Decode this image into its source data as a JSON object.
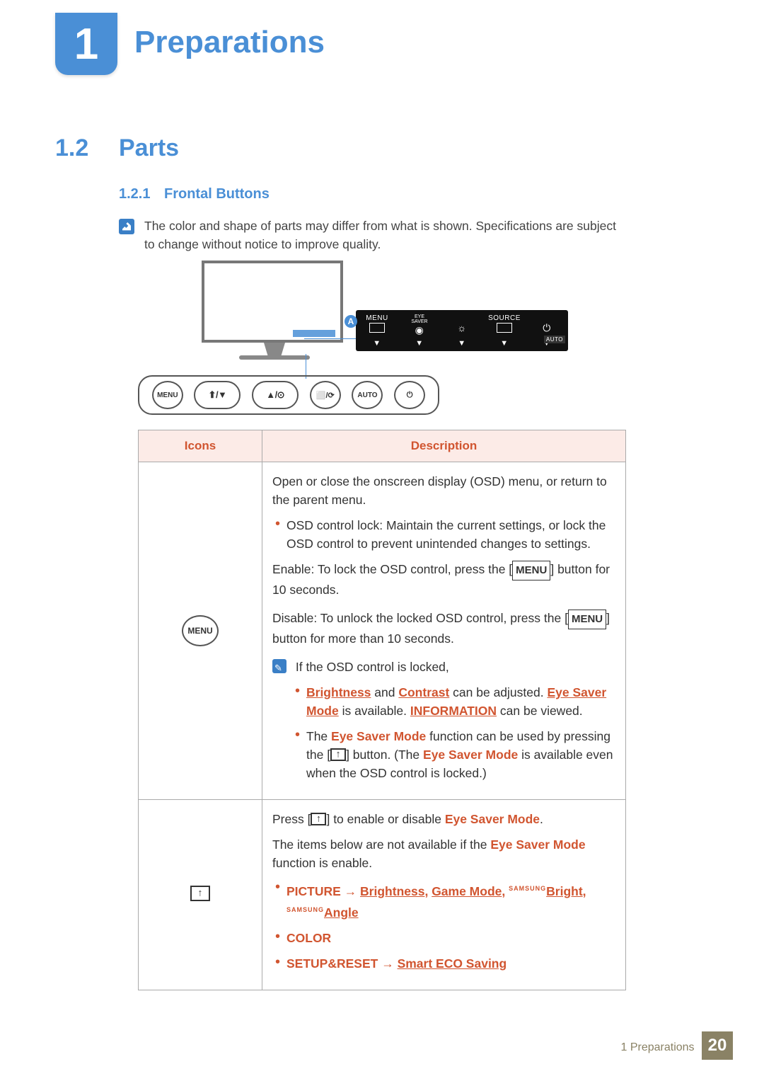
{
  "chapter": {
    "num": "1",
    "title": "Preparations"
  },
  "section": {
    "num": "1.2",
    "title": "Parts"
  },
  "subsection": {
    "num": "1.2.1",
    "title": "Frontal Buttons"
  },
  "note": "The color and shape of parts may differ from what is shown. Specifications are subject to change without notice to improve quality.",
  "osd": {
    "badge": "A",
    "items": [
      "MENU",
      "EYE\nSAVER",
      "",
      "SOURCE",
      ""
    ],
    "auto_label": "AUTO"
  },
  "front_buttons": [
    "MENU",
    "⬆/▼",
    "▲/⊙",
    "⬜/⟳",
    "AUTO",
    "⏻"
  ],
  "table": {
    "headers": [
      "Icons",
      "Description"
    ],
    "row1": {
      "icon_label": "MENU",
      "p1": "Open or close the onscreen display (OSD) menu, or return to the parent menu.",
      "b1": "OSD control lock: Maintain the current settings, or lock the OSD control to prevent unintended changes to settings.",
      "p2a": "Enable: To lock the OSD control, press the [",
      "p2b": "] button for 10 seconds.",
      "p3a": "Disable: To unlock the locked OSD control, press the [",
      "p3b": "] button for more than 10 seconds.",
      "note_intro": "If the OSD control is locked,",
      "nb1_a": "Brightness",
      "nb1_b": " and ",
      "nb1_c": "Contrast",
      "nb1_d": " can be adjusted. ",
      "nb1_e": "Eye Saver Mode",
      "nb1_f": " is available. ",
      "nb1_g": "INFORMATION",
      "nb1_h": " can be viewed.",
      "nb2_a": "The ",
      "nb2_b": "Eye Saver Mode",
      "nb2_c": " function can be used by pressing the [",
      "nb2_d": "] button. (The ",
      "nb2_e": "Eye Saver Mode",
      "nb2_f": " is available even when the OSD control is locked.)",
      "menu_label": "MENU"
    },
    "row2": {
      "p1a": "Press [",
      "p1b": "] to enable or disable ",
      "p1c": "Eye Saver Mode",
      "p1d": ".",
      "p2a": "The items below are not available if the ",
      "p2b": "Eye Saver Mode",
      "p2c": " function is enable.",
      "b1_a": "PICTURE",
      "b1_arrow": " → ",
      "b1_b": "Brightness",
      "b1_c": ", ",
      "b1_d": "Game Mode",
      "b1_e": ", ",
      "b1_mp": "SAMSUNG",
      "b1_f": "Bright",
      "b1_g": ", ",
      "b1_h": "Angle",
      "b2": "COLOR",
      "b3_a": "SETUP&RESET",
      "b3_arrow": " → ",
      "b3_b": "Smart ECO Saving"
    }
  },
  "footer": {
    "text": "1 Preparations",
    "page": "20"
  }
}
